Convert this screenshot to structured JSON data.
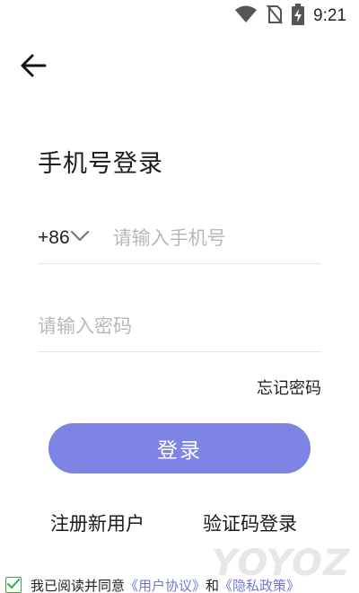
{
  "status_bar": {
    "time": "9:21",
    "icons": [
      "wifi-icon",
      "no-sim-icon",
      "battery-charging-icon"
    ]
  },
  "nav": {
    "back_icon": "arrow-left-icon"
  },
  "page": {
    "title": "手机号登录"
  },
  "phone": {
    "country_code": "+86",
    "chevron_icon": "chevron-down-icon",
    "placeholder": "请输入手机号",
    "value": ""
  },
  "password": {
    "placeholder": "请输入密码",
    "value": ""
  },
  "forgot_label": "忘记密码",
  "login_label": "登录",
  "register_label": "注册新用户",
  "sms_login_label": "验证码登录",
  "agreement": {
    "checked": true,
    "prefix": "我已阅读并同意",
    "user_agreement": "《用户协议》",
    "and": "和",
    "privacy_policy": "《隐私政策》"
  },
  "watermark": "YOYOZ",
  "colors": {
    "accent": "#7e84e3",
    "link": "#6f76d9",
    "check": "#3aa54a"
  }
}
